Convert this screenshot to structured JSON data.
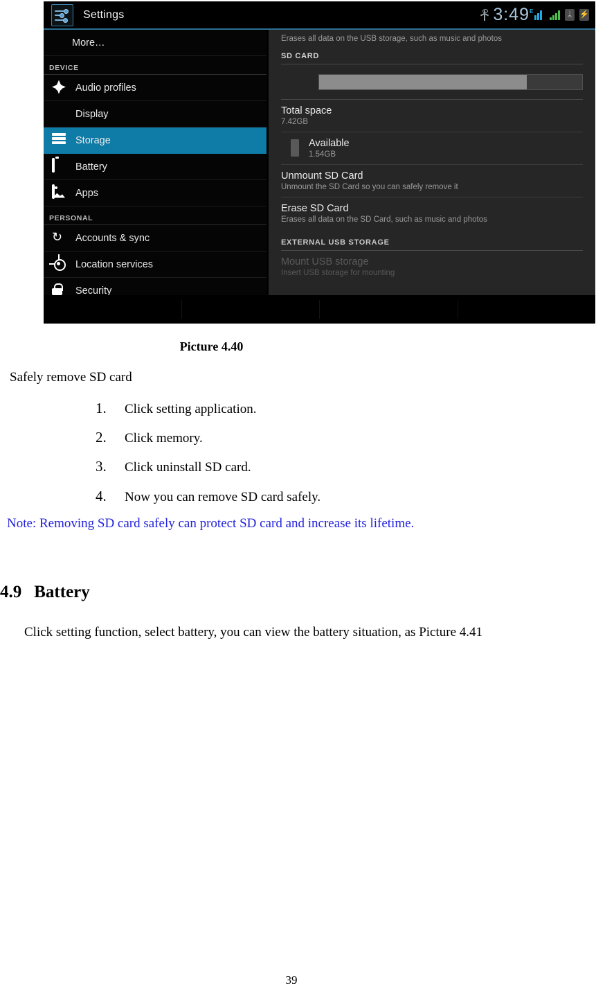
{
  "screenshot": {
    "action_bar": {
      "app_icon": "settings-sliders-icon",
      "title": "Settings"
    },
    "status_bar": {
      "usb_icon": "usb-icon",
      "time": "3:49",
      "signal_edge_label": "E",
      "signal_primary_icon": "signal-bars-blue-icon",
      "signal_secondary_icon": "signal-bars-green-icon",
      "bluetooth_icon": "bluetooth-icon",
      "bluetooth_glyph": "ᛦ",
      "battery_icon": "battery-charging-icon",
      "battery_glyph": "⚡"
    },
    "sidebar": {
      "items": [
        {
          "label": "More…",
          "icon": "none",
          "kind": "row-indent",
          "selected": false
        },
        {
          "label": "DEVICE",
          "kind": "section"
        },
        {
          "label": "Audio profiles",
          "icon": "audio-profiles-icon",
          "kind": "row",
          "selected": false
        },
        {
          "label": "Display",
          "icon": "display-icon",
          "kind": "row",
          "selected": false
        },
        {
          "label": "Storage",
          "icon": "storage-icon",
          "kind": "row",
          "selected": true
        },
        {
          "label": "Battery",
          "icon": "battery-icon",
          "kind": "row",
          "selected": false
        },
        {
          "label": "Apps",
          "icon": "apps-icon",
          "kind": "row",
          "selected": false
        },
        {
          "label": "PERSONAL",
          "kind": "section"
        },
        {
          "label": "Accounts & sync",
          "icon": "sync-icon",
          "kind": "row",
          "selected": false
        },
        {
          "label": "Location services",
          "icon": "location-icon",
          "kind": "row",
          "selected": false
        },
        {
          "label": "Security",
          "icon": "lock-icon",
          "kind": "row",
          "selected": false
        }
      ]
    },
    "detail": {
      "top_caption": "Erases all data on the USB storage, such as music and photos",
      "sd_card_section": "SD CARD",
      "usage_meter_percent": 79,
      "total_space": {
        "title": "Total space",
        "value": "7.42GB"
      },
      "available": {
        "title": "Available",
        "value": "1.54GB",
        "swatch": "storage-legend-swatch"
      },
      "unmount": {
        "title": "Unmount SD Card",
        "sub": "Unmount the SD Card so you can safely remove it"
      },
      "erase": {
        "title": "Erase SD Card",
        "sub": "Erases all data on the SD Card, such as music and photos"
      },
      "usb_section": "EXTERNAL USB STORAGE",
      "mount_usb": {
        "title": "Mount USB storage",
        "sub": "Insert USB storage for mounting"
      }
    },
    "colors": {
      "accent_selected": "#0f7ba7",
      "accent_rule": "#2c6f94",
      "clock": "#a9c6dc",
      "meter_fill": "#8c8c8c",
      "panel_bg": "#262626"
    }
  },
  "document": {
    "figure_caption": "Picture 4.40",
    "intro": "Safely remove SD card",
    "steps": [
      {
        "num": "1.",
        "text": "Click setting application."
      },
      {
        "num": "2.",
        "text": "Click memory."
      },
      {
        "num": "3.",
        "text": "Click uninstall SD card."
      },
      {
        "num": "4.",
        "text": "Now you can remove SD card safely."
      }
    ],
    "note": "Note: Removing SD card safely can protect SD card and increase its lifetime.",
    "note_color": "#2222dd",
    "heading": {
      "number": "4.9",
      "title": "Battery"
    },
    "paragraph": "Click setting function, select battery, you can view the battery situation, as Picture 4.41",
    "page_number": "39"
  }
}
